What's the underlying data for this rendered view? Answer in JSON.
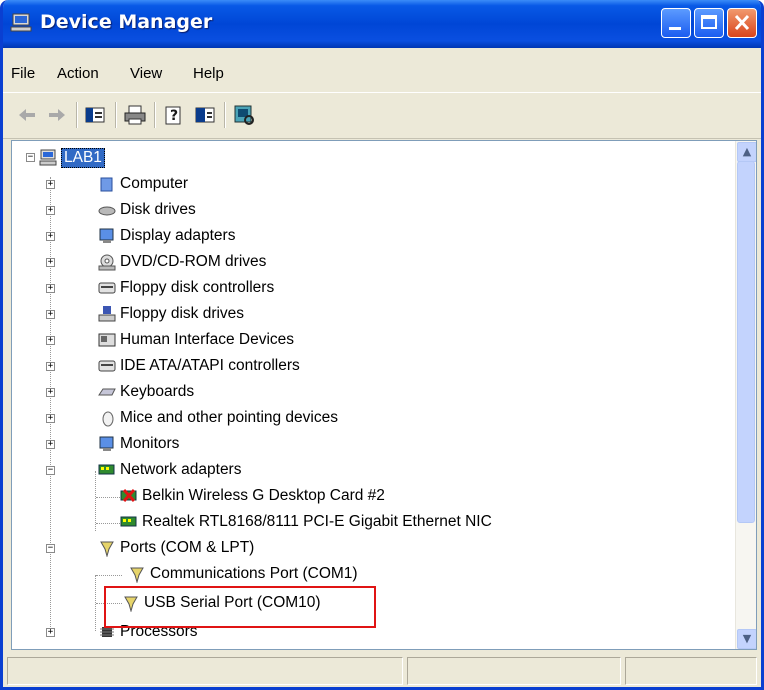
{
  "window": {
    "title": "Device Manager"
  },
  "menu": [
    "File",
    "Action",
    "View",
    "Help"
  ],
  "toolbar": [
    "back-icon",
    "forward-icon",
    "show-hide-tree-icon",
    "print-icon",
    "help-icon",
    "properties-icon",
    "scan-hardware-icon"
  ],
  "tree": {
    "root": "LAB1",
    "items": [
      {
        "label": "Computer",
        "icon": "computer-icon",
        "state": "collapsed"
      },
      {
        "label": "Disk drives",
        "icon": "disk-drive-icon",
        "state": "collapsed"
      },
      {
        "label": "Display adapters",
        "icon": "display-adapter-icon",
        "state": "collapsed"
      },
      {
        "label": "DVD/CD-ROM drives",
        "icon": "cdrom-icon",
        "state": "collapsed"
      },
      {
        "label": "Floppy disk controllers",
        "icon": "controller-icon",
        "state": "collapsed"
      },
      {
        "label": "Floppy disk drives",
        "icon": "floppy-icon",
        "state": "collapsed"
      },
      {
        "label": "Human Interface Devices",
        "icon": "hid-icon",
        "state": "collapsed"
      },
      {
        "label": "IDE ATA/ATAPI controllers",
        "icon": "controller-icon",
        "state": "collapsed"
      },
      {
        "label": "Keyboards",
        "icon": "keyboard-icon",
        "state": "collapsed"
      },
      {
        "label": "Mice and other pointing devices",
        "icon": "mouse-icon",
        "state": "collapsed"
      },
      {
        "label": "Monitors",
        "icon": "monitor-icon",
        "state": "collapsed"
      },
      {
        "label": "Network adapters",
        "icon": "network-adapter-icon",
        "state": "expanded",
        "children": [
          {
            "label": "Belkin Wireless G Desktop Card #2",
            "icon": "network-adapter-disabled-icon"
          },
          {
            "label": "Realtek RTL8168/8111 PCI-E Gigabit Ethernet NIC",
            "icon": "network-adapter-icon"
          }
        ]
      },
      {
        "label": "Ports (COM & LPT)",
        "icon": "port-icon",
        "state": "expanded",
        "children": [
          {
            "label": "Communications Port (COM1)",
            "icon": "port-icon"
          },
          {
            "label": "USB Serial Port (COM10)",
            "icon": "port-icon"
          }
        ]
      },
      {
        "label": "Processors",
        "icon": "processor-icon",
        "state": "collapsed"
      }
    ]
  },
  "colors": {
    "titlebar": "#0046d6",
    "highlight": "#e01414",
    "selection": "#316ac5"
  }
}
